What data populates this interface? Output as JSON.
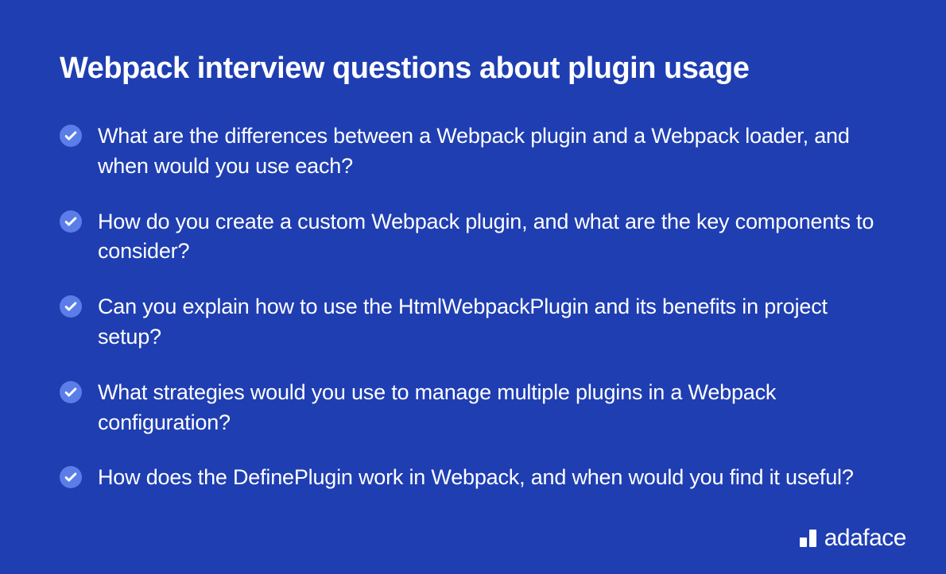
{
  "title": "Webpack interview questions about plugin usage",
  "questions": [
    "What are the differences between a Webpack plugin and a Webpack loader, and when would you use each?",
    "How do you create a custom Webpack plugin, and what are the key components to consider?",
    "Can you explain how to use the HtmlWebpackPlugin and its benefits in project setup?",
    "What strategies would you use to manage multiple plugins in a Webpack configuration?",
    "How does the DefinePlugin work in Webpack, and when would you find it useful?"
  ],
  "brand": {
    "name": "adaface"
  },
  "colors": {
    "background": "#1f3eb2",
    "text": "#ffffff",
    "checkIcon": "#5a7de8"
  }
}
